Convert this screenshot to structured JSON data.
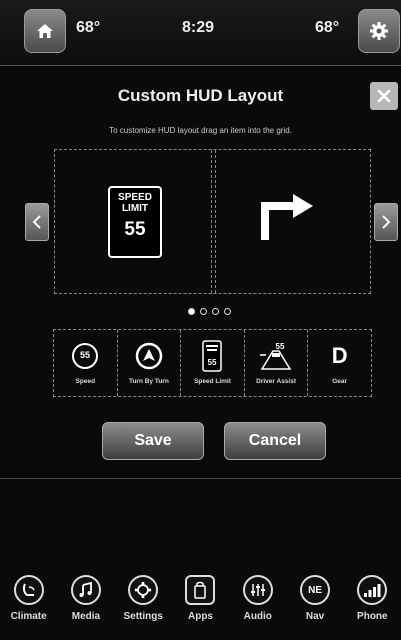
{
  "status": {
    "temp_left": "68°",
    "clock": "8:29",
    "temp_right": "68°"
  },
  "dialog": {
    "title": "Custom HUD Layout",
    "instructions": "To customize HUD layout drag an item into the grid."
  },
  "grid": {
    "speed_sign_label_1": "SPEED",
    "speed_sign_label_2": "LIMIT",
    "speed_sign_value": "55"
  },
  "pager": {
    "total": 4,
    "active": 1
  },
  "tray": {
    "speed": {
      "label": "Speed",
      "value": "55"
    },
    "turn": {
      "label": "Turn By Turn"
    },
    "speed_limit": {
      "label": "Speed Limit",
      "value": "55"
    },
    "driver_assist": {
      "label": "Driver Assist",
      "value": "55"
    },
    "gear": {
      "label": "Gear",
      "value": "D"
    }
  },
  "buttons": {
    "save": "Save",
    "cancel": "Cancel"
  },
  "nav": {
    "climate": "Climate",
    "media": "Media",
    "settings": "Settings",
    "apps": "Apps",
    "audio": "Audio",
    "nav": "Nav",
    "nav_heading": "NE",
    "phone": "Phone"
  }
}
